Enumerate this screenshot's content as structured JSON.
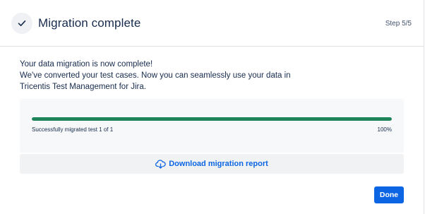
{
  "header": {
    "title": "Migration complete",
    "step": "Step 5/5",
    "status_icon": "checkmark-icon"
  },
  "message": {
    "line1": "Your data migration is now complete!",
    "line2": "We've converted your test cases. Now you can seamlessly use your data in",
    "line3": "Tricentis Test Management for Jira."
  },
  "progress": {
    "label": "Successfully migrated test 1 of 1",
    "percent_label": "100%",
    "fraction": 1.0,
    "color": "#1f845a"
  },
  "download": {
    "label": "Download migration report",
    "icon": "cloud-download-icon"
  },
  "footer": {
    "done_label": "Done"
  },
  "colors": {
    "primary": "#0c66e4",
    "success": "#1f845a"
  }
}
